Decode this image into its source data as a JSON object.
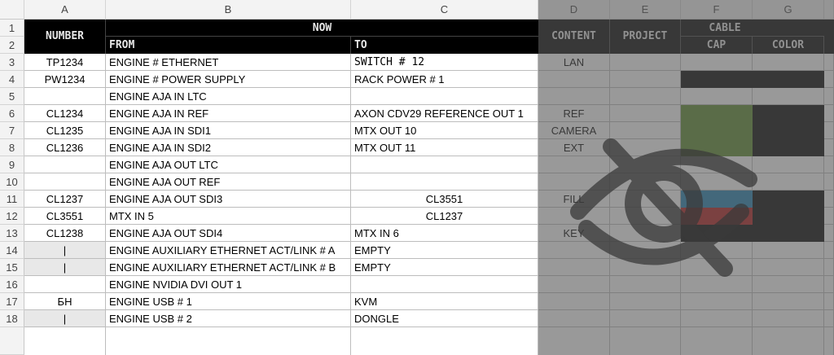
{
  "columns": [
    "A",
    "B",
    "C",
    "D",
    "E",
    "F",
    "G"
  ],
  "rows": [
    "1",
    "2",
    "3",
    "4",
    "5",
    "6",
    "7",
    "8",
    "9",
    "10",
    "11",
    "12",
    "13",
    "14",
    "15",
    "16",
    "17",
    "18"
  ],
  "header": {
    "number": "NUMBER",
    "now": "NOW",
    "from": "FROM",
    "to": "TO",
    "content": "CONTENT",
    "project": "PROJECT",
    "cable": "CABLE",
    "cap": "CAP",
    "color": "COLOR"
  },
  "data_rows": [
    {
      "row": "3",
      "number": "TP1234",
      "from": "ENGINE # ETHERNET",
      "to": "SWITCH  #  12",
      "content": "LAN"
    },
    {
      "row": "4",
      "number": "PW1234",
      "from": "ENGINE # POWER SUPPLY",
      "to": "RACK POWER # 1",
      "content": ""
    },
    {
      "row": "5",
      "number": "",
      "from": "ENGINE AJA IN LTC",
      "to": "",
      "content": ""
    },
    {
      "row": "6",
      "number": "CL1234",
      "from": "ENGINE AJA IN REF",
      "to": "AXON CDV29 REFERENCE OUT 1",
      "content": "REF"
    },
    {
      "row": "7",
      "number": "CL1235",
      "from": "ENGINE AJA IN SDI1",
      "to": "MTX OUT 10",
      "content": "CAMERA"
    },
    {
      "row": "8",
      "number": "CL1236",
      "from": "ENGINE AJA IN SDI2",
      "to": "MTX OUT 11",
      "content": "EXT"
    },
    {
      "row": "9",
      "number": "",
      "from": "ENGINE AJA OUT LTC",
      "to": "",
      "content": ""
    },
    {
      "row": "10",
      "number": "",
      "from": "ENGINE AJA OUT REF",
      "to": "",
      "content": ""
    },
    {
      "row": "11",
      "number": "CL1237",
      "from": "ENGINE AJA OUT SDI3",
      "to": "CL3551",
      "content": "FILL"
    },
    {
      "row": "12",
      "number": "CL3551",
      "from": "MTX IN 5",
      "to": "CL1237",
      "content": ""
    },
    {
      "row": "13",
      "number": "CL1238",
      "from": "ENGINE AJA OUT SDI4",
      "to": "MTX IN 6",
      "content": "KEY"
    },
    {
      "row": "14",
      "number": "|",
      "from": "ENGINE AUXILIARY ETHERNET ACT/LINK # A",
      "to": "EMPTY",
      "content": ""
    },
    {
      "row": "15",
      "number": "|",
      "from": "ENGINE AUXILIARY ETHERNET ACT/LINK # B",
      "to": "EMPTY",
      "content": ""
    },
    {
      "row": "16",
      "number": "",
      "from": "ENGINE NVIDIA DVI OUT 1",
      "to": "",
      "content": ""
    },
    {
      "row": "17",
      "number": "БН",
      "from": "ENGINE USB # 1",
      "to": "KVM",
      "content": ""
    },
    {
      "row": "18",
      "number": "|",
      "from": "ENGINE USB # 2",
      "to": "DONGLE",
      "content": ""
    }
  ],
  "colors": {
    "green": "#5a8a2a",
    "blue": "#1f7fb0",
    "red": "#b01818",
    "black": "#000000",
    "overlay_gray": "#5a5a5a"
  },
  "watermark_icon": "hidden-eye-icon"
}
